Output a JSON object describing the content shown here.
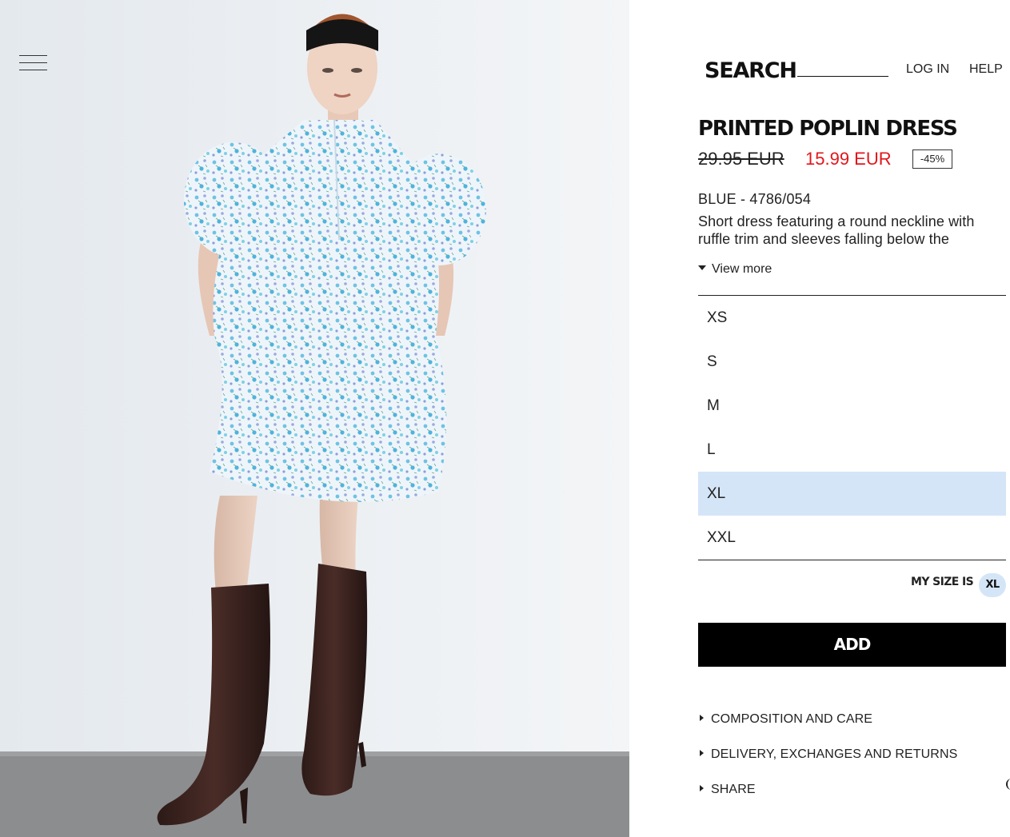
{
  "header": {
    "search_label": "SEARCH",
    "login_label": "LOG IN",
    "help_label": "HELP"
  },
  "product": {
    "name": "PRINTED POPLIN DRESS",
    "old_price": "29.95 EUR",
    "new_price": "15.99 EUR",
    "discount": "-45%",
    "color_ref": "BLUE - 4786/054",
    "description": "Short dress featuring a round neckline with ruffle trim and sleeves falling below the",
    "view_more_label": "View more"
  },
  "sizes": [
    {
      "label": "XS",
      "selected": false
    },
    {
      "label": "S",
      "selected": false
    },
    {
      "label": "M",
      "selected": false
    },
    {
      "label": "L",
      "selected": false
    },
    {
      "label": "XL",
      "selected": true
    },
    {
      "label": "XXL",
      "selected": false
    }
  ],
  "my_size": {
    "label": "MY SIZE IS",
    "value": "XL"
  },
  "add_button_label": "ADD",
  "accordion": [
    {
      "label": "COMPOSITION AND CARE"
    },
    {
      "label": "DELIVERY, EXCHANGES AND RETURNS"
    },
    {
      "label": "SHARE"
    }
  ],
  "colors": {
    "sale_price": "#e2161b",
    "selected_size_bg": "#d4e5f7",
    "add_button_bg": "#000000"
  },
  "icons": {
    "menu": "hamburger-menu-icon",
    "view_more": "caret-down-icon",
    "accordion": "caret-right-icon"
  }
}
